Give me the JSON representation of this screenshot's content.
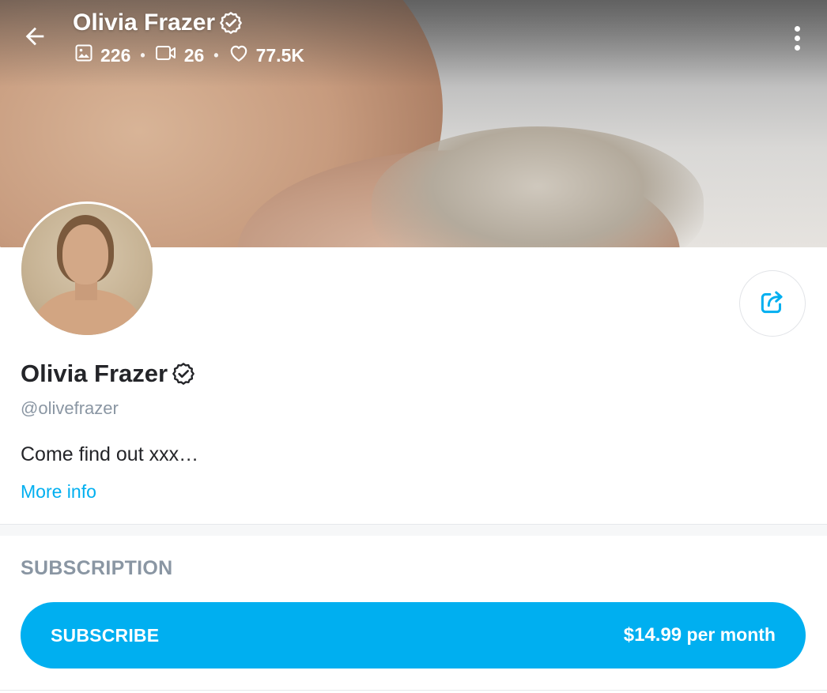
{
  "header": {
    "name": "Olivia Frazer",
    "stats": {
      "photos": "226",
      "videos": "26",
      "likes": "77.5K"
    },
    "separator": "•"
  },
  "icons": {
    "back": "back-arrow-icon",
    "verified": "verified-badge-icon",
    "photos": "image-icon",
    "videos": "video-camera-icon",
    "likes": "heart-icon",
    "more": "more-vertical-icon",
    "share": "share-icon"
  },
  "profile": {
    "name": "Olivia Frazer",
    "handle": "@olivefrazer",
    "bio": "Come find out xxx…",
    "more_info": "More info"
  },
  "subscription": {
    "heading": "SUBSCRIPTION",
    "button_label": "SUBSCRIBE",
    "price": "$14.99",
    "period": " per month"
  },
  "colors": {
    "accent": "#00aff0",
    "text_primary": "#242529",
    "text_muted": "#8a96a3"
  }
}
